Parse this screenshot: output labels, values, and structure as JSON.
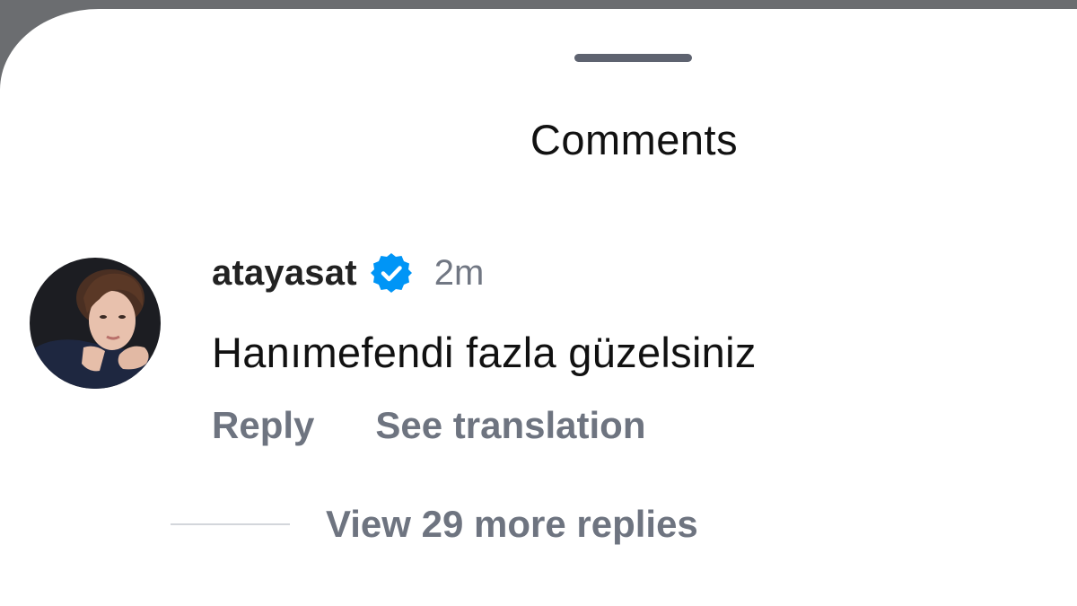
{
  "sheet": {
    "title": "Comments"
  },
  "comment": {
    "username": "atayasat",
    "verified": true,
    "time": "2m",
    "text": "Hanımefendi fazla güzelsiniz",
    "actions": {
      "reply_label": "Reply",
      "translate_label": "See translation"
    },
    "replies_label": "View 29 more replies"
  },
  "icons": {
    "verified": "verified-badge-icon",
    "avatar": "avatar"
  },
  "colors": {
    "verified_blue": "#0095f6",
    "secondary_text": "#6e7480",
    "primary_text": "#111111",
    "handle": "#5e6370"
  }
}
